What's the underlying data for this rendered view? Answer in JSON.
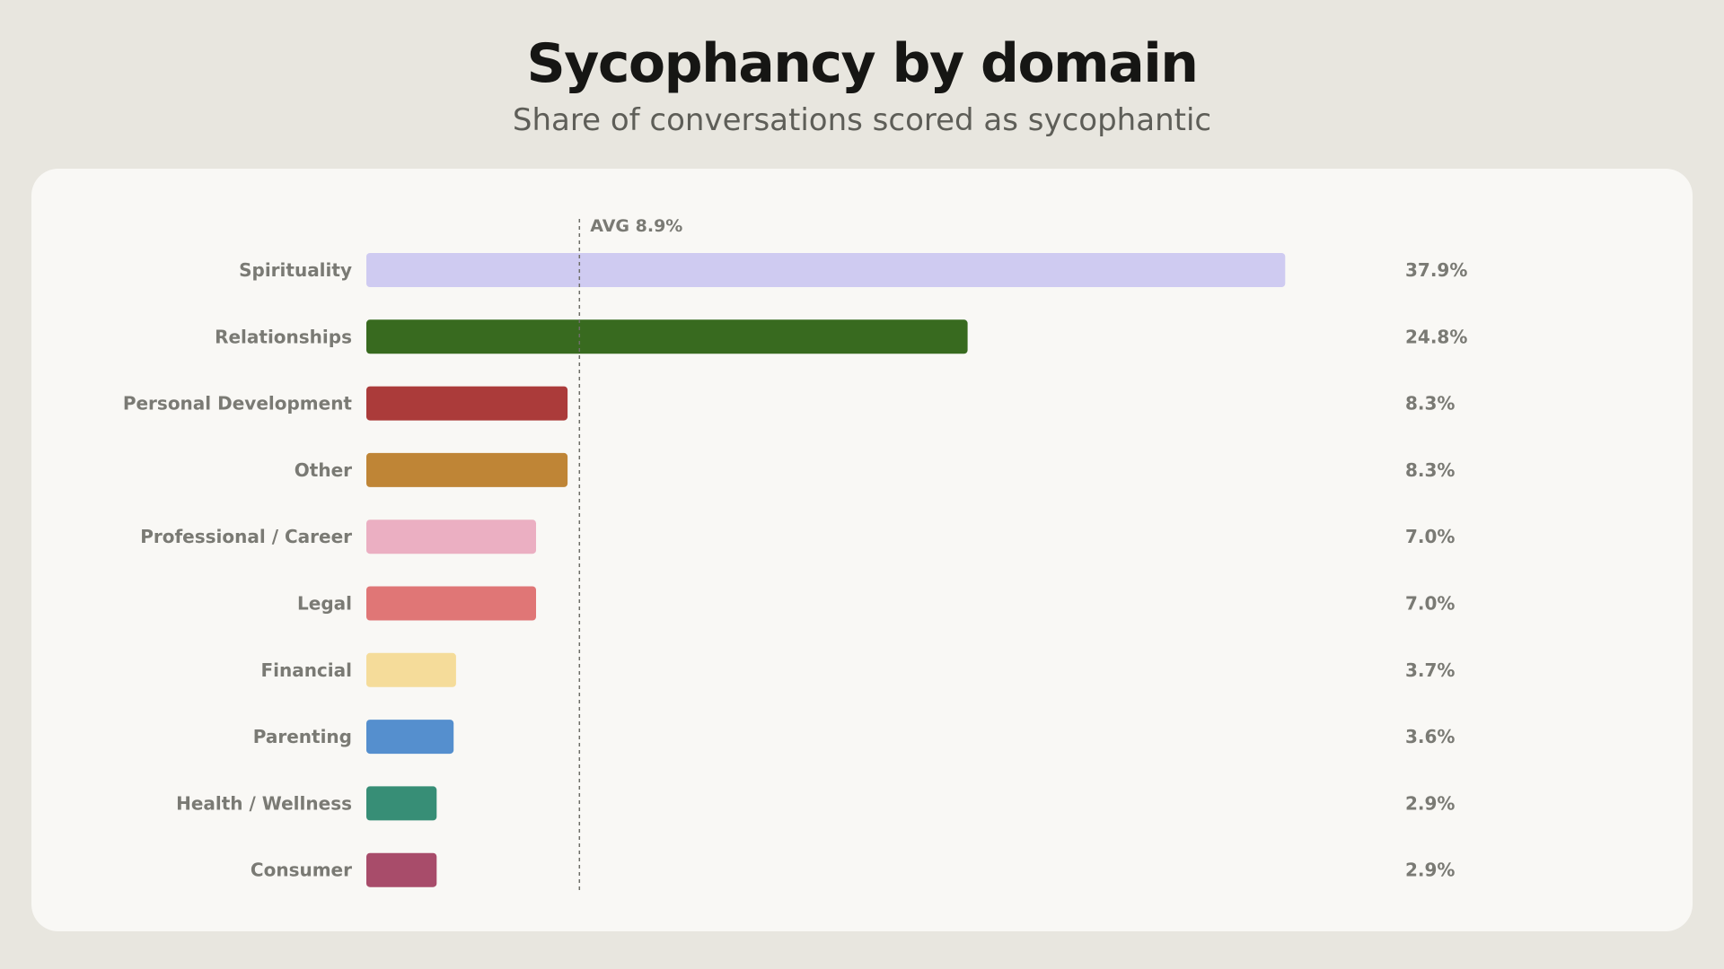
{
  "chart_data": {
    "type": "bar",
    "orientation": "horizontal",
    "title": "Sycophancy by domain",
    "subtitle": "Share of conversations scored as sycophantic",
    "xlabel": "",
    "ylabel": "",
    "xlim": [
      0,
      40
    ],
    "grid": false,
    "legend": "none",
    "categories": [
      "Spirituality",
      "Relationships",
      "Personal Development",
      "Other",
      "Professional / Career",
      "Legal",
      "Financial",
      "Parenting",
      "Health / Wellness",
      "Consumer"
    ],
    "values": [
      37.9,
      24.8,
      8.3,
      8.3,
      7.0,
      7.0,
      3.7,
      3.6,
      2.9,
      2.9
    ],
    "value_labels": [
      "37.9%",
      "24.8%",
      "8.3%",
      "8.3%",
      "7.0%",
      "7.0%",
      "3.7%",
      "3.6%",
      "2.9%",
      "2.9%"
    ],
    "colors": [
      "#cfcbf1",
      "#386a1f",
      "#ab3b3a",
      "#bf8536",
      "#ebafc2",
      "#e07676",
      "#f5dc9a",
      "#558fce",
      "#378e76",
      "#a84c6a"
    ],
    "reference_line": {
      "value": 8.9,
      "label": "AVG 8.9%",
      "style": "dashed"
    }
  }
}
